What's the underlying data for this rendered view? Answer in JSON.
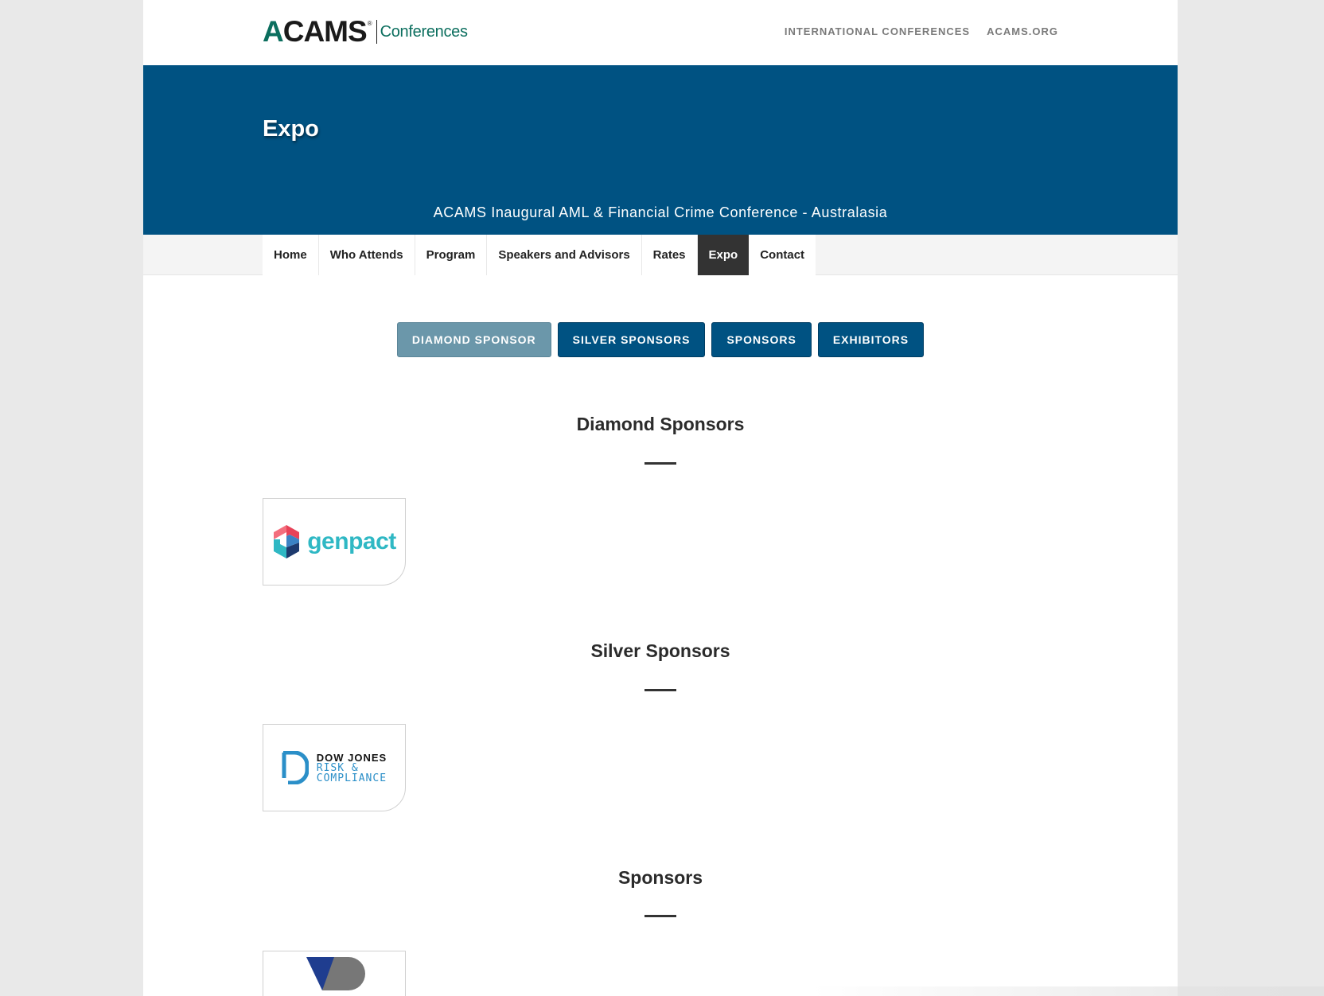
{
  "header": {
    "logo_main": "ACAMS",
    "logo_reg": "®",
    "logo_sub": "Conferences",
    "links": [
      "INTERNATIONAL CONFERENCES",
      "ACAMS.ORG"
    ]
  },
  "hero": {
    "title": "Expo",
    "subtitle": "ACAMS Inaugural AML & Financial Crime Conference - Australasia"
  },
  "nav": {
    "items": [
      "Home",
      "Who Attends",
      "Program",
      "Speakers and Advisors",
      "Rates",
      "Expo",
      "Contact"
    ],
    "active": "Expo"
  },
  "tabs": {
    "items": [
      "DIAMOND SPONSOR",
      "SILVER SPONSORS",
      "SPONSORS",
      "EXHIBITORS"
    ],
    "active": "DIAMOND SPONSOR"
  },
  "sections": {
    "diamond": {
      "title": "Diamond Sponsors",
      "logo_text": "genpact"
    },
    "silver": {
      "title": "Silver Sponsors",
      "logo_line1": "DOW JONES",
      "logo_line2": "RISK &",
      "logo_line3": "COMPLIANCE"
    },
    "sponsors": {
      "title": "Sponsors"
    }
  },
  "colors": {
    "brand_blue": "#005282",
    "brand_green": "#0b6e5e",
    "tab_active": "#6b97aa",
    "nav_active": "#333333"
  }
}
